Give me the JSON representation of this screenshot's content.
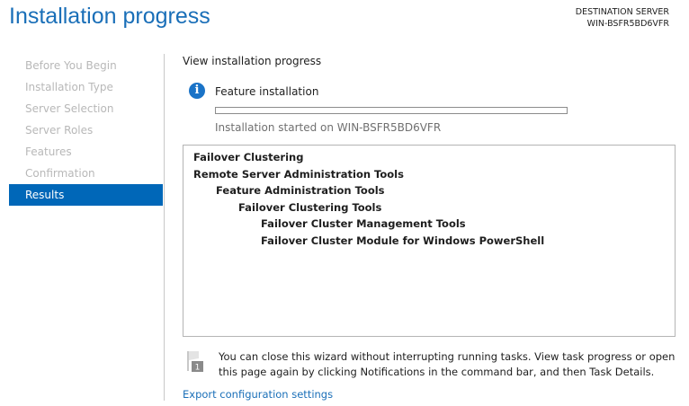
{
  "header": {
    "title": "Installation progress",
    "dest_label": "DESTINATION SERVER",
    "dest_server": "WIN-BSFR5BD6VFR"
  },
  "nav": [
    {
      "label": "Before You Begin"
    },
    {
      "label": "Installation Type"
    },
    {
      "label": "Server Selection"
    },
    {
      "label": "Server Roles"
    },
    {
      "label": "Features"
    },
    {
      "label": "Confirmation"
    },
    {
      "label": "Results"
    }
  ],
  "main": {
    "subtitle": "View installation progress",
    "status_title": "Feature installation",
    "progress_percent": 0,
    "status_text": "Installation started on WIN-BSFR5BD6VFR",
    "items": [
      {
        "label": "Failover Clustering",
        "level": 0
      },
      {
        "label": "Remote Server Administration Tools",
        "level": 0
      },
      {
        "label": "Feature Administration Tools",
        "level": 1
      },
      {
        "label": "Failover Clustering Tools",
        "level": 2
      },
      {
        "label": "Failover Cluster Management Tools",
        "level": 3
      },
      {
        "label": "Failover Cluster Module for Windows PowerShell",
        "level": 3
      }
    ],
    "notification_badge": "1",
    "note": "You can close this wizard without interrupting running tasks. View task progress or open this page again by clicking Notifications in the command bar, and then Task Details.",
    "export_link": "Export configuration settings"
  }
}
